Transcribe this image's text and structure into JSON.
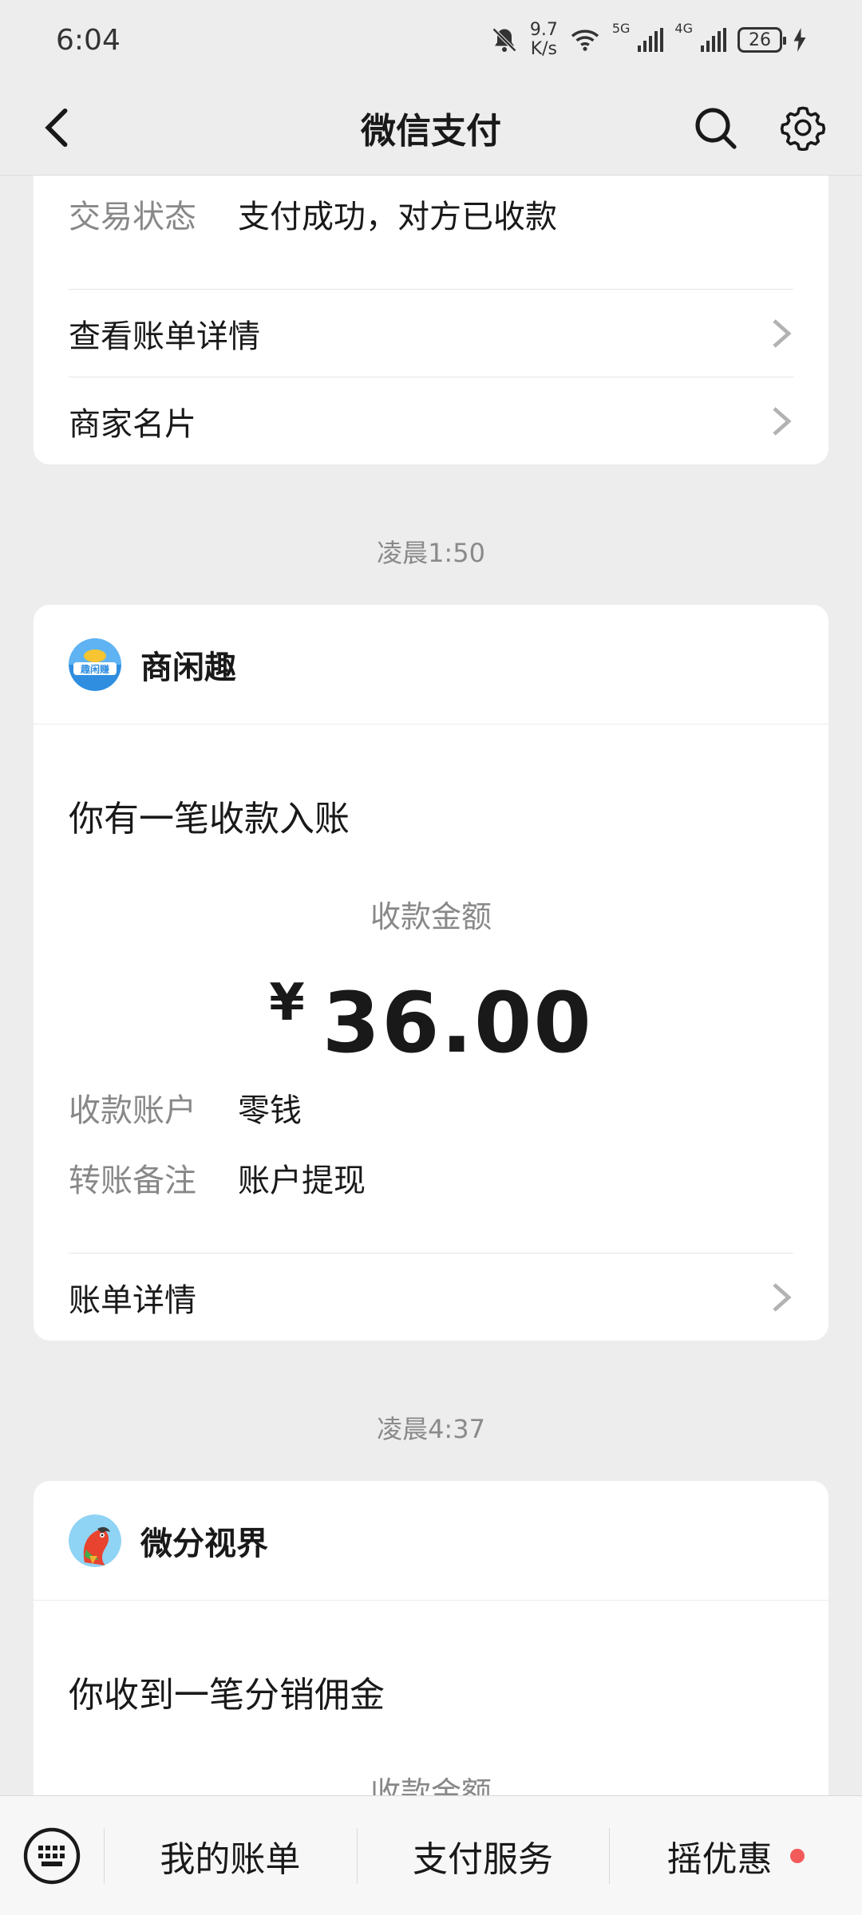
{
  "status_bar": {
    "time": "6:04",
    "speed_value": "9.7",
    "speed_unit": "K/s",
    "net1": "5G",
    "net2": "4G",
    "battery": "26"
  },
  "nav": {
    "title": "微信支付",
    "back_icon": "back-chevron-icon",
    "search_icon": "search-icon",
    "settings_icon": "gear-icon"
  },
  "card1": {
    "status_label": "交易状态",
    "status_value": "支付成功，对方已收款",
    "view_bill_label": "查看账单详情",
    "merchant_card_label": "商家名片"
  },
  "timestamp1": "凌晨1:50",
  "card2": {
    "merchant_name": "商闲趣",
    "notice_title": "你有一笔收款入账",
    "amount_label": "收款金额",
    "currency": "¥",
    "amount": "36.00",
    "account_label": "收款账户",
    "account_value": "零钱",
    "remark_label": "转账备注",
    "remark_value": "账户提现",
    "bill_detail_label": "账单详情"
  },
  "timestamp2": "凌晨4:37",
  "card3": {
    "merchant_name": "微分视界",
    "notice_title": "你收到一笔分销佣金",
    "amount_label": "收款金额"
  },
  "bottom_bar": {
    "keyboard_icon": "keyboard-icon",
    "item1": "我的账单",
    "item2": "支付服务",
    "item3": "摇优惠",
    "dot_color": "#f35a5a"
  },
  "colors": {
    "background": "#ededed",
    "card": "#ffffff",
    "text_primary": "#191919",
    "text_secondary": "#888888"
  }
}
